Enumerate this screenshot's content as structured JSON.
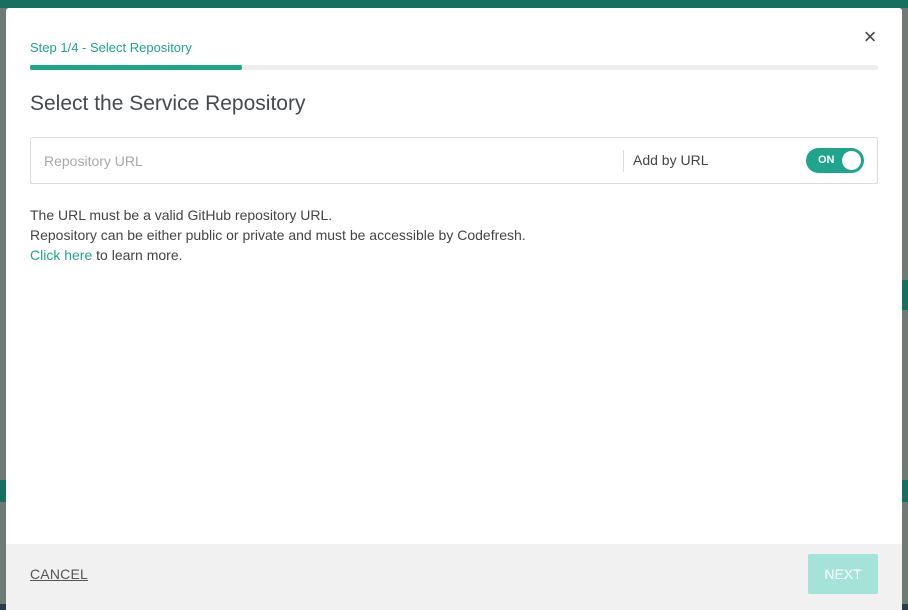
{
  "modal": {
    "step_label": "Step 1/4 - Select Repository",
    "progress_fraction": 0.25,
    "title": "Select the Service Repository",
    "close_icon": "close-icon"
  },
  "repo": {
    "placeholder": "Repository URL",
    "value": "",
    "add_by_url_label": "Add by URL",
    "toggle_state": "ON"
  },
  "help": {
    "line1": "The URL must be a valid GitHub repository URL.",
    "line2": "Repository can be either public or private and must be accessible by Codefresh.",
    "link_text": "Click here",
    "link_suffix": " to learn more."
  },
  "footer": {
    "cancel_label": "CANCEL",
    "next_label": "NEXT"
  },
  "colors": {
    "accent": "#1fa58c",
    "next_disabled": "#a5e3d8"
  }
}
